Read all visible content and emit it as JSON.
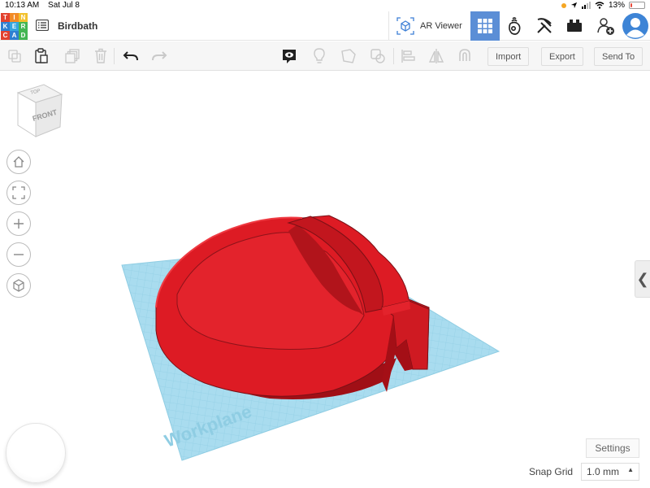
{
  "status_bar": {
    "time": "10:13 AM",
    "date": "Sat Jul 8",
    "battery": "13%",
    "battery_level": 0.13
  },
  "app": {
    "logo_letters": [
      "T",
      "I",
      "N",
      "K",
      "E",
      "R",
      "C",
      "A",
      "D"
    ],
    "logo_colors": [
      "#e2412e",
      "#f28b26",
      "#f2c12e",
      "#2e7fd1",
      "#36a6de",
      "#43b653",
      "#e2412e",
      "#2e7fd1",
      "#43b653"
    ],
    "design_title": "Birdbath"
  },
  "topbar": {
    "ar_viewer_label": "AR Viewer",
    "views": [
      {
        "icon": "3d-view-grid-icon",
        "active": true
      },
      {
        "icon": "blocks-view-icon",
        "active": false
      },
      {
        "icon": "bricks-view-icon",
        "active": false
      },
      {
        "icon": "lego-view-icon",
        "active": false
      }
    ],
    "add_user_icon": "add-user-icon",
    "avatar_icon": "user-avatar-icon",
    "accent_color": "#5b8ed6"
  },
  "toolbar": {
    "import_label": "Import",
    "export_label": "Export",
    "send_to_label": "Send To"
  },
  "viewport": {
    "view_cube": {
      "top_label": "TOP",
      "front_label": "FRONT"
    },
    "workplane_label": "Workplane",
    "shape_color": "#dd1b24",
    "workplane_color": "#a9dcef",
    "settings_label": "Settings",
    "snap_grid_label": "Snap Grid",
    "snap_grid_value": "1.0 mm"
  }
}
